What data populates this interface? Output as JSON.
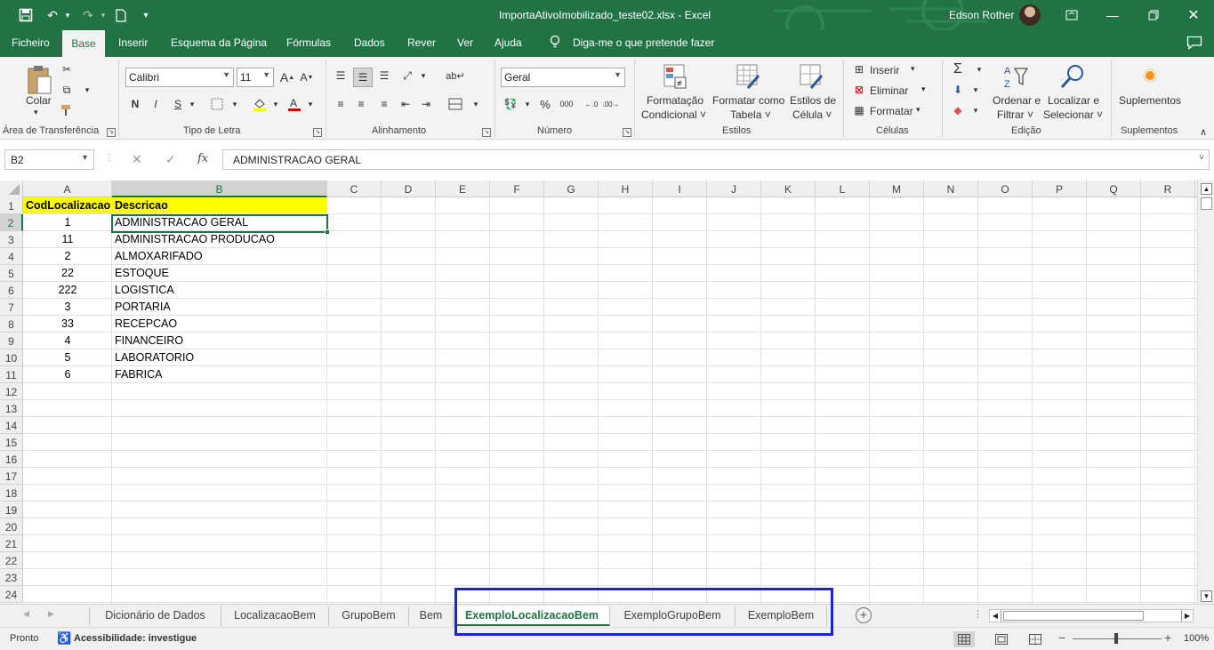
{
  "titlebar": {
    "doc_title": "ImportaAtivoImobilizado_teste02.xlsx  -  Excel",
    "user_name": "Edson Rother"
  },
  "menu": {
    "items": [
      "Ficheiro",
      "Base",
      "Inserir",
      "Esquema da Página",
      "Fórmulas",
      "Dados",
      "Rever",
      "Ver",
      "Ajuda"
    ],
    "tell_me": "Diga-me o que pretende fazer"
  },
  "ribbon": {
    "clipboard": {
      "paste": "Colar",
      "label": "Área de Transferência"
    },
    "font": {
      "name": "Calibri",
      "size": "11",
      "label": "Tipo de Letra"
    },
    "alignment": {
      "label": "Alinhamento"
    },
    "number": {
      "format": "Geral",
      "label": "Número"
    },
    "styles": {
      "conditional": [
        "Formatação",
        "Condicional"
      ],
      "table": [
        "Formatar como",
        "Tabela"
      ],
      "cell": [
        "Estilos de",
        "Célula"
      ],
      "label": "Estilos"
    },
    "cells": {
      "insert": "Inserir",
      "delete": "Eliminar",
      "format": "Formatar",
      "label": "Células"
    },
    "editing": {
      "sort": [
        "Ordenar e",
        "Filtrar"
      ],
      "find": [
        "Localizar e",
        "Selecionar"
      ],
      "label": "Edição"
    },
    "addins": {
      "button": "Suplementos",
      "label": "Suplementos"
    }
  },
  "formula_bar": {
    "name_box": "B2",
    "content": "ADMINISTRACAO GERAL"
  },
  "grid": {
    "columns": [
      "A",
      "B",
      "C",
      "D",
      "E",
      "F",
      "G",
      "H",
      "I",
      "J",
      "K",
      "L",
      "M",
      "N",
      "O",
      "P",
      "Q",
      "R"
    ],
    "rows": [
      "1",
      "2",
      "3",
      "4",
      "5",
      "6",
      "7",
      "8",
      "9",
      "10",
      "11",
      "12",
      "13",
      "14",
      "15",
      "16",
      "17",
      "18",
      "19",
      "20",
      "21",
      "22",
      "23",
      "24"
    ],
    "header": [
      "CodLocalizacao",
      "Descricao"
    ],
    "data": [
      [
        "1",
        "ADMINISTRACAO GERAL"
      ],
      [
        "11",
        "ADMINISTRACAO PRODUCAO"
      ],
      [
        "2",
        "ALMOXARIFADO"
      ],
      [
        "22",
        "ESTOQUE"
      ],
      [
        "222",
        "LOGISTICA"
      ],
      [
        "3",
        "PORTARIA"
      ],
      [
        "33",
        "RECEPCAO"
      ],
      [
        "4",
        "FINANCEIRO"
      ],
      [
        "5",
        "LABORATORIO"
      ],
      [
        "6",
        "FABRICA"
      ]
    ]
  },
  "sheets": {
    "tabs": [
      "Dicionário de Dados",
      "LocalizacaoBem",
      "GrupoBem",
      "Bem",
      "ExemploLocalizacaoBem",
      "ExemploGrupoBem",
      "ExemploBem"
    ],
    "active": "ExemploLocalizacaoBem"
  },
  "status": {
    "ready": "Pronto",
    "accessibility": "Acessibilidade: investigue",
    "zoom": "100%"
  },
  "colors": {
    "excel_green": "#217346",
    "header_fill": "#ffff00",
    "highlight_border": "#1d23d6"
  }
}
